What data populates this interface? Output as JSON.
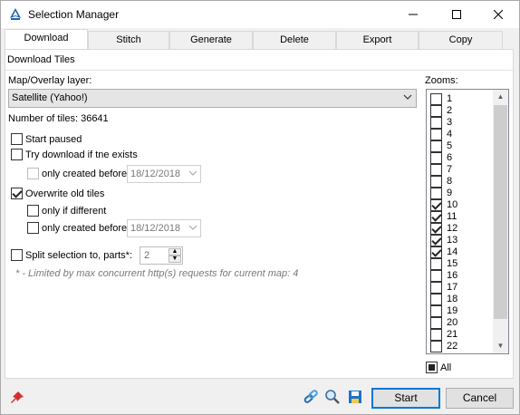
{
  "window": {
    "title": "Selection Manager",
    "icon": "app-logo-icon"
  },
  "tabs": [
    {
      "label": "Download",
      "active": true
    },
    {
      "label": "Stitch",
      "active": false
    },
    {
      "label": "Generate",
      "active": false
    },
    {
      "label": "Delete",
      "active": false
    },
    {
      "label": "Export",
      "active": false
    },
    {
      "label": "Copy",
      "active": false
    }
  ],
  "download": {
    "section_title": "Download Tiles",
    "map_layer_label": "Map/Overlay layer:",
    "map_layer_value": "Satellite (Yahoo!)",
    "tiles_count": "Number of tiles: 36641",
    "start_paused": {
      "label": "Start paused",
      "checked": false
    },
    "try_download": {
      "label": "Try download if tne exists",
      "checked": false
    },
    "only_created_before_1": {
      "label": "only created before",
      "checked": false,
      "date": "18/12/2018"
    },
    "overwrite_old": {
      "label": "Overwrite old tiles",
      "checked": true
    },
    "only_if_different": {
      "label": "only if different",
      "checked": false
    },
    "only_created_before_2": {
      "label": "only created before",
      "checked": false,
      "date": "18/12/2018"
    },
    "split_selection": {
      "label": "Split selection to, parts*:",
      "checked": false,
      "value": "2"
    },
    "note": "* - Limited by max concurrent http(s) requests for current map: 4"
  },
  "zooms": {
    "label": "Zooms:",
    "items": [
      {
        "label": "1",
        "checked": false
      },
      {
        "label": "2",
        "checked": false
      },
      {
        "label": "3",
        "checked": false
      },
      {
        "label": "4",
        "checked": false
      },
      {
        "label": "5",
        "checked": false
      },
      {
        "label": "6",
        "checked": false
      },
      {
        "label": "7",
        "checked": false
      },
      {
        "label": "8",
        "checked": false
      },
      {
        "label": "9",
        "checked": false
      },
      {
        "label": "10",
        "checked": true
      },
      {
        "label": "11",
        "checked": true
      },
      {
        "label": "12",
        "checked": true
      },
      {
        "label": "13",
        "checked": true
      },
      {
        "label": "14",
        "checked": true
      },
      {
        "label": "15",
        "checked": false
      },
      {
        "label": "16",
        "checked": false
      },
      {
        "label": "17",
        "checked": false
      },
      {
        "label": "18",
        "checked": false
      },
      {
        "label": "19",
        "checked": false
      },
      {
        "label": "20",
        "checked": false
      },
      {
        "label": "21",
        "checked": false
      },
      {
        "label": "22",
        "checked": false
      }
    ],
    "all_label": "All"
  },
  "footer": {
    "start_label": "Start",
    "cancel_label": "Cancel",
    "icons": [
      "pin-icon",
      "link-icon",
      "zoom-search-icon",
      "save-icon"
    ]
  },
  "colors": {
    "accent": "#0078d7",
    "checkbox_pressed": "#222222"
  }
}
